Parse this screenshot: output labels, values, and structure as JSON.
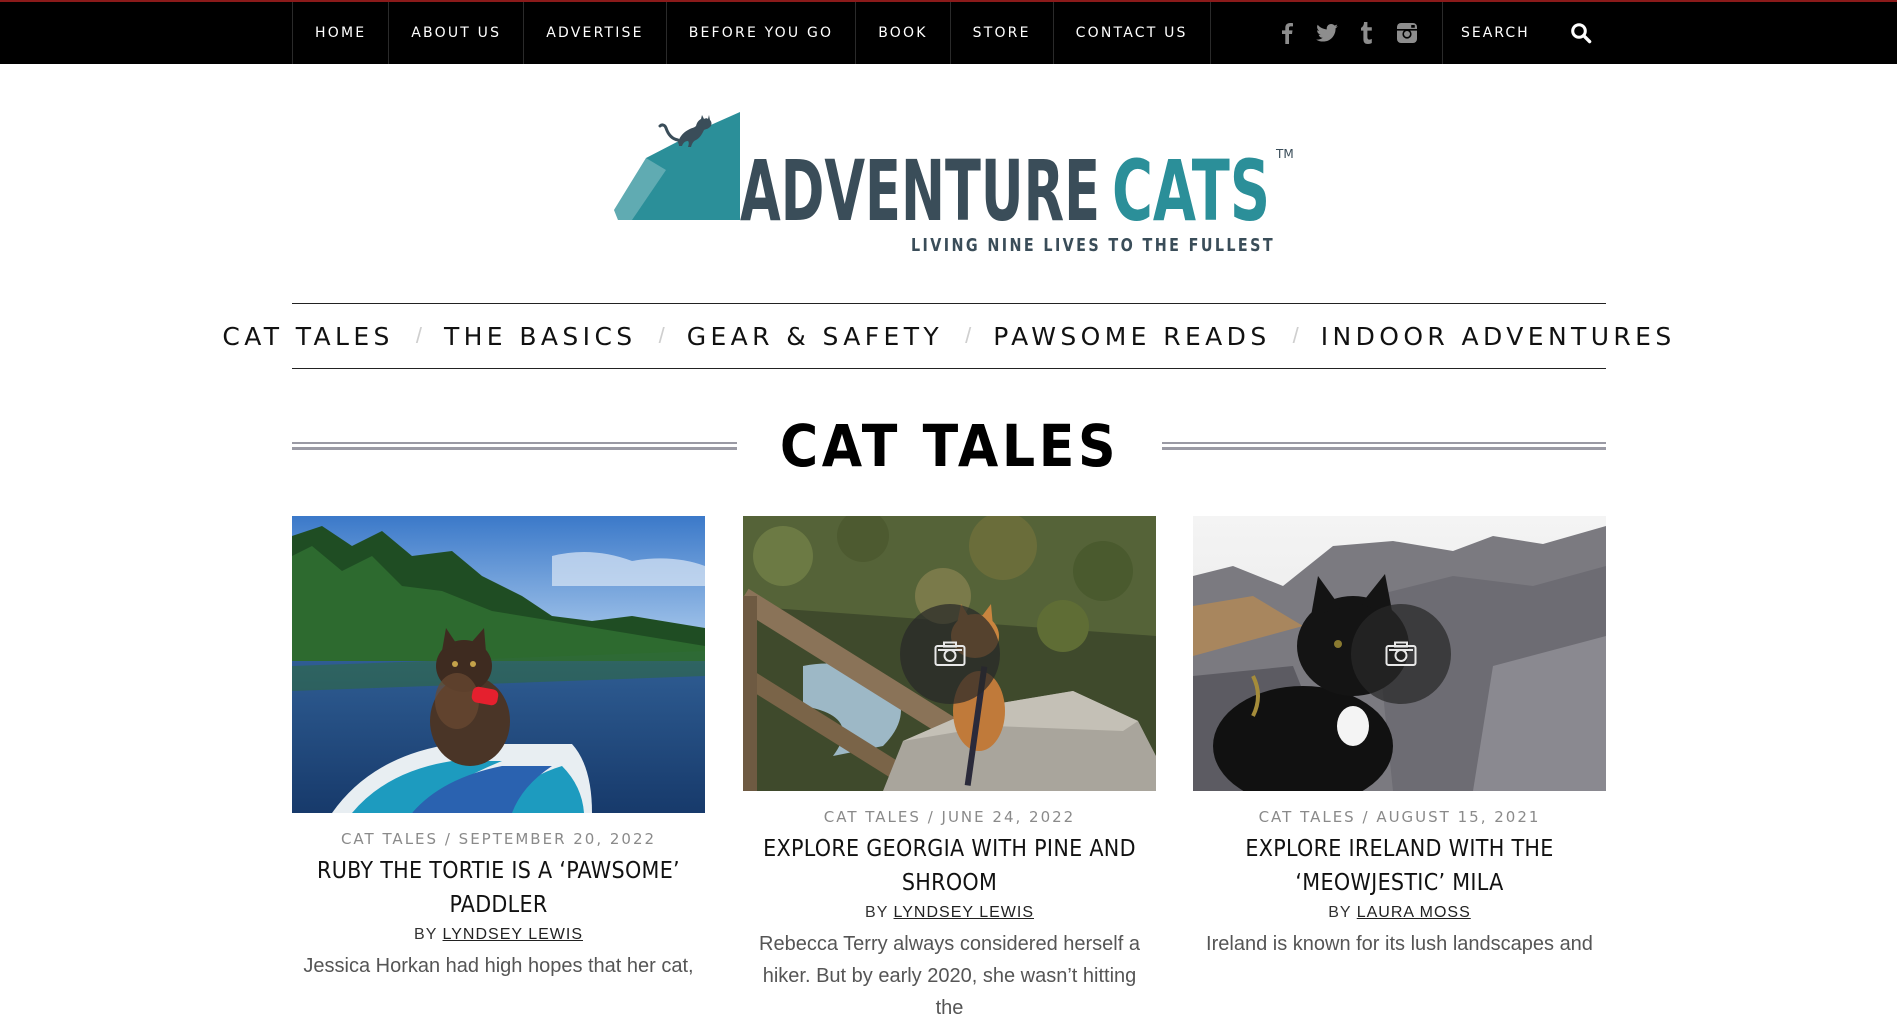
{
  "topnav": {
    "items": [
      "HOME",
      "ABOUT US",
      "ADVERTISE",
      "BEFORE YOU GO",
      "BOOK",
      "STORE",
      "CONTACT US"
    ],
    "social_icons": [
      "facebook-icon",
      "twitter-icon",
      "tumblr-icon",
      "instagram-icon"
    ],
    "search_placeholder": "SEARCH"
  },
  "logo": {
    "word1": "ADVENTURE",
    "word2": "CATS",
    "trademark": "TM",
    "tagline": "LIVING NINE LIVES TO THE FULLEST"
  },
  "catnav": {
    "items": [
      "CAT TALES",
      "THE BASICS",
      "GEAR & SAFETY",
      "PAWSOME READS",
      "INDOOR ADVENTURES"
    ],
    "separator": "/"
  },
  "section": {
    "title": "CAT TALES"
  },
  "colors": {
    "brand_teal": "#2b8f99",
    "brand_slate": "#3a4d59",
    "topbar_bg": "#000000",
    "topbar_accent": "#8b1a1a"
  },
  "posts": [
    {
      "category": "CAT TALES",
      "date": "SEPTEMBER 20, 2022",
      "title": "RUBY THE TORTIE IS A ‘PAWSOME’ PADDLER",
      "by": "BY",
      "author": "LYNDSEY LEWIS",
      "excerpt": "Jessica Horkan had high hopes that her cat,"
    },
    {
      "category": "CAT TALES",
      "date": "JUNE 24, 2022",
      "title": "EXPLORE GEORGIA WITH PINE AND SHROOM",
      "by": "BY",
      "author": "LYNDSEY LEWIS",
      "excerpt": "Rebecca Terry always considered herself a hiker. But by early 2020, she wasn’t hitting the"
    },
    {
      "category": "CAT TALES",
      "date": "AUGUST 15, 2021",
      "title": "EXPLORE IRELAND WITH THE ‘MEOWJESTIC’ MILA",
      "by": "BY",
      "author": "LAURA MOSS",
      "excerpt": "Ireland is known for its lush landscapes and"
    }
  ]
}
